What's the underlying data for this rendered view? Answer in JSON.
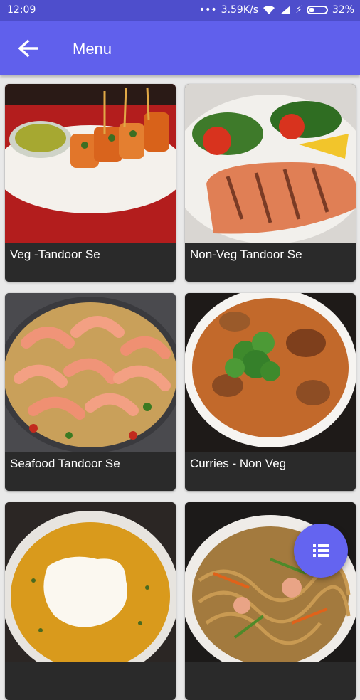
{
  "status_bar": {
    "time": "12:09",
    "network_speed": "3.59K/s",
    "battery": "32%",
    "battery_level": 0.32
  },
  "app_bar": {
    "back_icon": "arrow-left-icon",
    "title": "Menu"
  },
  "menu_items": [
    {
      "label": "Veg -Tandoor Se",
      "image": "paneer-tikka-photo"
    },
    {
      "label": "Non-Veg Tandoor Se",
      "image": "grilled-salmon-photo"
    },
    {
      "label": "Seafood Tandoor Se",
      "image": "shrimp-rice-photo"
    },
    {
      "label": "Curries - Non Veg",
      "image": "meat-curry-photo"
    },
    {
      "label": "",
      "image": "yellow-soup-photo"
    },
    {
      "label": "",
      "image": "noodles-photo"
    }
  ],
  "fab": {
    "icon": "list-icon"
  },
  "colors": {
    "status_bar": "#4e4ecc",
    "app_bar": "#6060ec",
    "fab": "#6464f0",
    "caption_bg": "#2a2a2a"
  }
}
